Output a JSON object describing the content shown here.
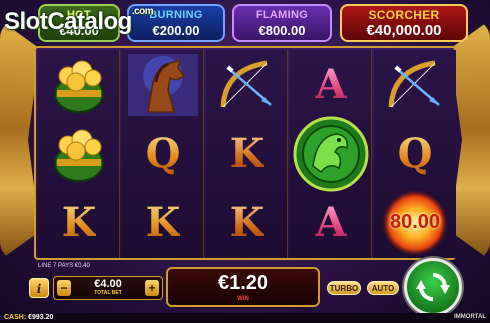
{
  "watermark": {
    "text": "SlotCatalog",
    "suffix": ".com"
  },
  "jackpots": [
    {
      "name": "HOT",
      "value": "€40.00",
      "color": "#9bd14a"
    },
    {
      "name": "BURNING",
      "value": "€200.00",
      "color": "#6fa4ff"
    },
    {
      "name": "FLAMING",
      "value": "€800.00",
      "color": "#c58cff"
    },
    {
      "name": "SCORCHER",
      "value": "€40,000.00",
      "color": "#ffcc55"
    }
  ],
  "reels": [
    [
      "pot-of-gold",
      "pot-of-gold",
      "K"
    ],
    [
      "horse",
      "Q",
      "K"
    ],
    [
      "bow-and-arrow",
      "K",
      "K"
    ],
    [
      "A",
      "dragon-medallion",
      "A"
    ],
    [
      "bow-and-arrow",
      "Q",
      "fireball"
    ]
  ],
  "fireball_value": "80.00",
  "line_info": "LINE 7 PAYS €0.40",
  "bet": {
    "value": "€4.00",
    "label": "TOTAL BET",
    "minus": "−",
    "plus": "+"
  },
  "win": {
    "value": "€1.20",
    "label": "WIN"
  },
  "buttons": {
    "info": "i",
    "turbo": "TURBO",
    "auto": "AUTO"
  },
  "status": {
    "cash_label": "CASH:",
    "cash_value": "€993.20",
    "game_name": "IMMORTAL"
  },
  "colors": {
    "accent_gold": "#d29b2c",
    "spin_green": "#157a1d",
    "background": "#2b1245"
  }
}
